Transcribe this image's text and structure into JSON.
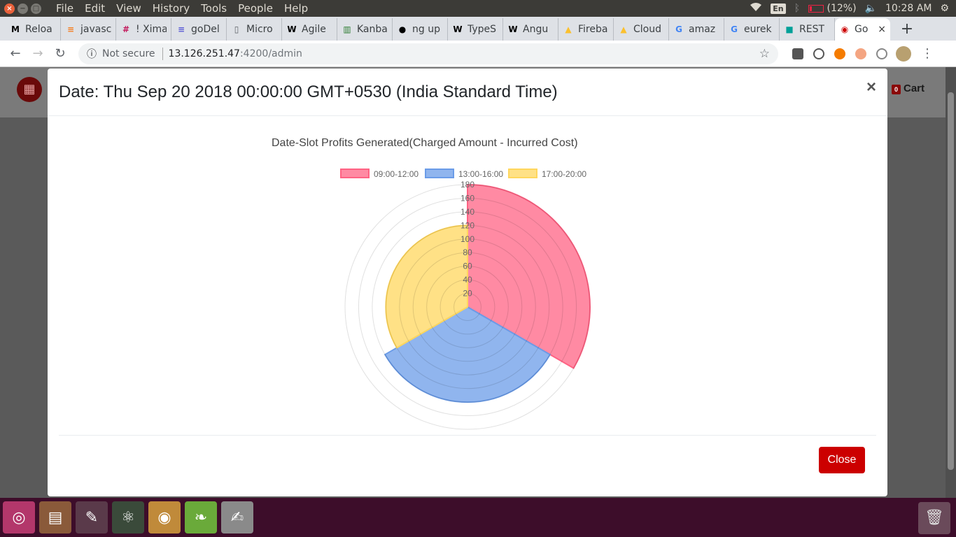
{
  "os": {
    "menu": [
      "File",
      "Edit",
      "View",
      "History",
      "Tools",
      "People",
      "Help"
    ],
    "lang": "En",
    "battery": "(12%)",
    "time": "10:28 AM",
    "window_close_glyph": "×",
    "window_min_glyph": "−",
    "window_max_glyph": "□"
  },
  "tabs": [
    {
      "title": "Reloa",
      "icon": "medium-icon",
      "fav": "M",
      "color": "#000000"
    },
    {
      "title": "javasc",
      "icon": "stackoverflow-icon",
      "fav": "≡",
      "color": "#f48024"
    },
    {
      "title": "! Xima",
      "icon": "hash-icon",
      "fav": "#",
      "color": "#c2185b"
    },
    {
      "title": "goDel",
      "icon": "doc-icon",
      "fav": "≡",
      "color": "#5b5bd6"
    },
    {
      "title": "Micro",
      "icon": "page-icon",
      "fav": "▯",
      "color": "#5f6368"
    },
    {
      "title": "Agile",
      "icon": "wikipedia-icon",
      "fav": "W",
      "color": "#000000"
    },
    {
      "title": "Kanba",
      "icon": "kanban-icon",
      "fav": "▥",
      "color": "#2e7d32"
    },
    {
      "title": "ng up",
      "icon": "github-icon",
      "fav": "●",
      "color": "#000000"
    },
    {
      "title": "TypeS",
      "icon": "wikipedia-icon",
      "fav": "W",
      "color": "#000000"
    },
    {
      "title": "Angu",
      "icon": "wikipedia-icon",
      "fav": "W",
      "color": "#000000"
    },
    {
      "title": "Fireba",
      "icon": "firebase-icon",
      "fav": "▲",
      "color": "#fbc02d"
    },
    {
      "title": "Cloud",
      "icon": "firebase-icon",
      "fav": "▲",
      "color": "#fbc02d"
    },
    {
      "title": "amaz",
      "icon": "google-icon",
      "fav": "G",
      "color": "#4285f4"
    },
    {
      "title": "eurek",
      "icon": "google-icon",
      "fav": "G",
      "color": "#4285f4"
    },
    {
      "title": "REST",
      "icon": "rest-icon",
      "fav": "■",
      "color": "#00a098"
    },
    {
      "title": "Go",
      "icon": "book-icon",
      "fav": "◉",
      "color": "#cc0000",
      "active": true
    }
  ],
  "new_tab": "+",
  "tab_close": "×",
  "nav": {
    "back": "←",
    "forward": "→",
    "reload": "↻",
    "info": "ⓘ",
    "not_secure": "Not secure",
    "url_host": "13.126.251.47",
    "url_path": ":4200/admin",
    "star": "☆",
    "kebab": "⋮"
  },
  "page": {
    "cart_badge": "0",
    "cart_label": "Cart",
    "brand_glyph": "▦"
  },
  "modal": {
    "title": "Date: Thu Sep 20 2018 00:00:00 GMT+0530 (India Standard Time)",
    "close_x": "×",
    "close_button": "Close"
  },
  "chart_data": {
    "type": "polarArea",
    "title": "Date-Slot Profits Generated(Charged Amount - Incurred Cost)",
    "labels": [
      "09:00-12:00",
      "13:00-16:00",
      "17:00-20:00"
    ],
    "values": [
      180,
      140,
      120
    ],
    "colors": [
      "#ff6384",
      "#6b9ce8",
      "#ffd75e"
    ],
    "r_range": [
      0,
      180
    ],
    "ticks": [
      20,
      40,
      60,
      80,
      100,
      120,
      140,
      160,
      180
    ],
    "legend_position": "top"
  },
  "taskbar": {
    "apps": [
      {
        "name": "ubuntu-launcher",
        "glyph": "◎",
        "bg": "#b3376b"
      },
      {
        "name": "files-launcher",
        "glyph": "▤",
        "bg": "#8a5a3a"
      },
      {
        "name": "settings-launcher",
        "glyph": "✎",
        "bg": "#5a3a4a"
      },
      {
        "name": "atom-launcher",
        "glyph": "⚛",
        "bg": "#3a4a3a"
      },
      {
        "name": "chrome-launcher",
        "glyph": "◉",
        "bg": "#c08a3a"
      },
      {
        "name": "spring-launcher",
        "glyph": "❧",
        "bg": "#6aaa3a"
      },
      {
        "name": "editor-launcher",
        "glyph": "✍",
        "bg": "#8a8a8a"
      }
    ],
    "trash": "🗑"
  }
}
